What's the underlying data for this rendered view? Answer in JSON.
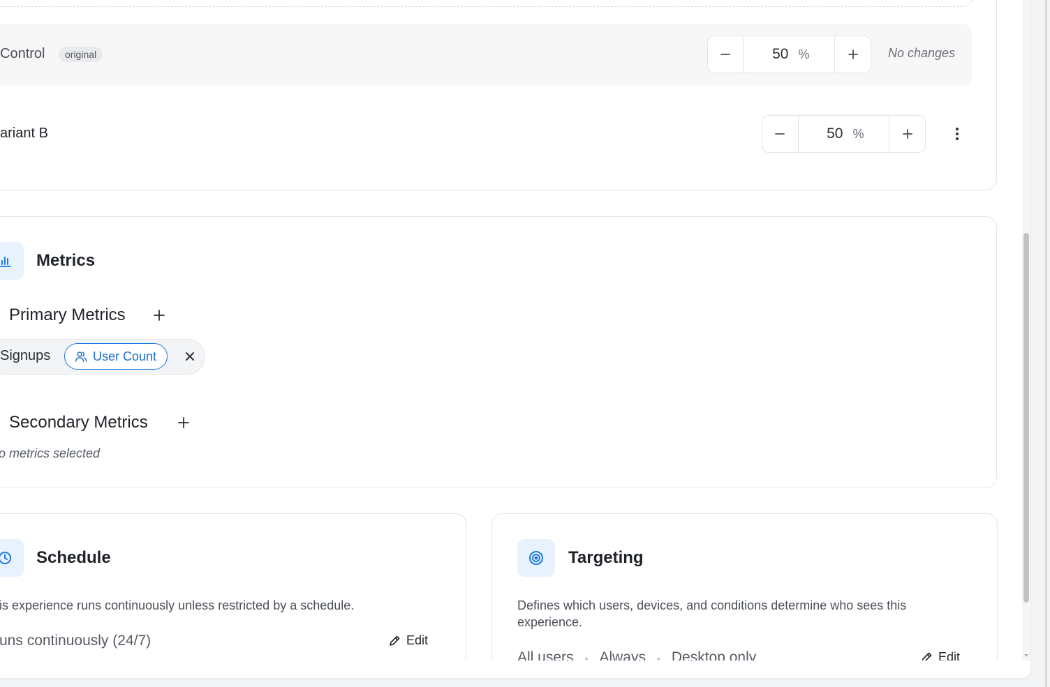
{
  "variants": {
    "control": {
      "name": "Control",
      "badge": "original",
      "value": "50",
      "unit": "%",
      "status": "No changes"
    },
    "variant_b": {
      "name": "ariant B",
      "value": "50",
      "unit": "%"
    }
  },
  "metrics": {
    "title": "Metrics",
    "primary_title": "Primary Metrics",
    "primary_item": {
      "name": "Signups",
      "tag": "User Count"
    },
    "secondary_title": "Secondary Metrics",
    "secondary_empty": "o metrics selected"
  },
  "schedule": {
    "title": "Schedule",
    "description": "is experience runs continuously unless restricted by a schedule.",
    "summary": "uns continuously (24/7)",
    "edit_label": "Edit"
  },
  "targeting": {
    "title": "Targeting",
    "description": "Defines which users, devices, and conditions determine who sees this experience.",
    "summary_parts": [
      "All users",
      "Always",
      "Desktop only"
    ],
    "edit_label": "Edit"
  },
  "colors": {
    "accent": "#1d7ae0",
    "tile_bg": "#e8f2fd",
    "border": "#e3e5e8"
  }
}
